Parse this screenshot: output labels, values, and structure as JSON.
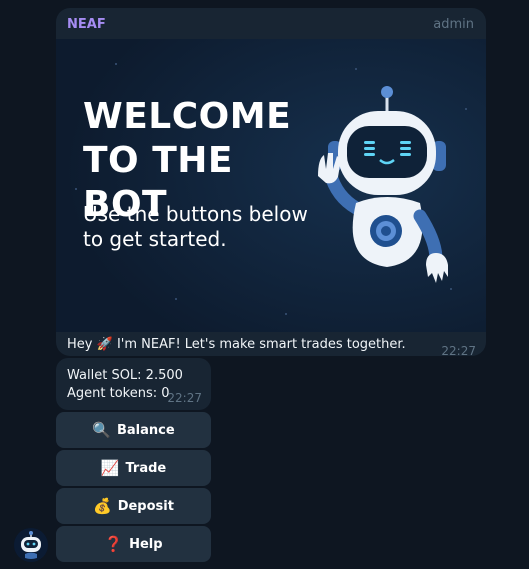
{
  "message": {
    "sender": "NEAF",
    "role": "admin",
    "banner": {
      "title_line1": "WELCOME",
      "title_line2": "TO THE BOT",
      "subtitle": "Use the buttons below to get started."
    },
    "caption_prefix": "Hey",
    "caption_emoji": "🚀",
    "caption_text": "I'm NEAF! Let's make smart trades together.",
    "time": "22:27"
  },
  "wallet": {
    "sol_line": "Wallet SOL: 2.500",
    "tokens_line": "Agent tokens: 0",
    "time": "22:27"
  },
  "keyboard": [
    {
      "emoji": "🔍",
      "label": "Balance"
    },
    {
      "emoji": "📈",
      "label": "Trade"
    },
    {
      "emoji": "💰",
      "label": "Deposit"
    },
    {
      "emoji": "❓",
      "label": "Help"
    }
  ],
  "colors": {
    "background": "#0e1621",
    "bubble": "#182533",
    "sender": "#a58cf2",
    "button": "#223140"
  }
}
